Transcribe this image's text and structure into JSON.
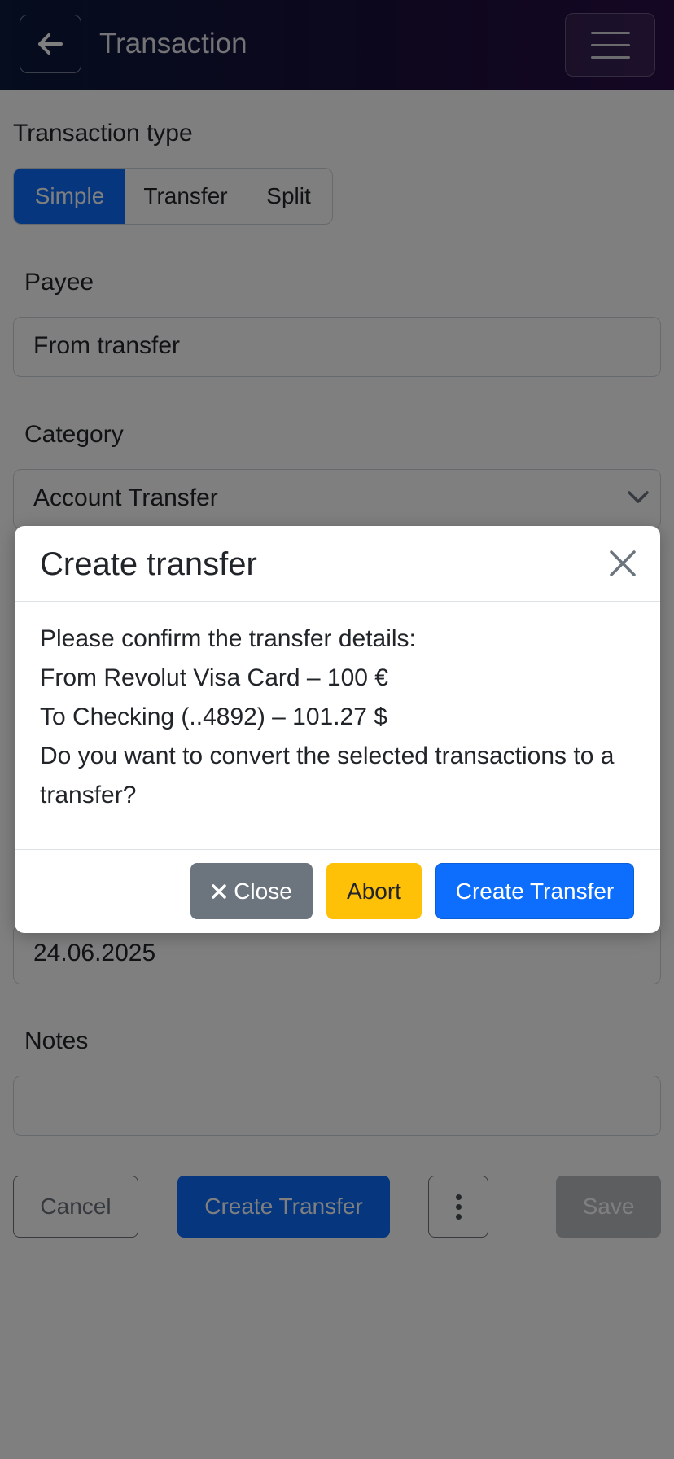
{
  "header": {
    "title": "Transaction",
    "back_icon": "arrow-left-icon",
    "menu_icon": "hamburger-menu-icon"
  },
  "form": {
    "type_label": "Transaction type",
    "type_options": [
      "Simple",
      "Transfer",
      "Split"
    ],
    "type_selected": "Simple",
    "payee_label": "Payee",
    "payee_value": "From transfer",
    "category_label": "Category",
    "category_value": "Account Transfer",
    "date_value": "24.06.2025",
    "notes_label": "Notes",
    "notes_value": ""
  },
  "actions": {
    "cancel_label": "Cancel",
    "create_transfer_label": "Create Transfer",
    "save_label": "Save"
  },
  "modal": {
    "title": "Create transfer",
    "line1": "Please confirm the transfer details:",
    "line2": "From Revolut Visa Card – 100 €",
    "line3": "To Checking (..4892) – 101.27 $",
    "line4": "Do you want to convert the selected transactions to a transfer?",
    "close_label": "Close",
    "abort_label": "Abort",
    "create_label": "Create Transfer"
  },
  "colors": {
    "primary": "#0d6efd",
    "secondary": "#6c757d",
    "warning": "#ffc107",
    "header_dark": "#0a1a3c"
  }
}
